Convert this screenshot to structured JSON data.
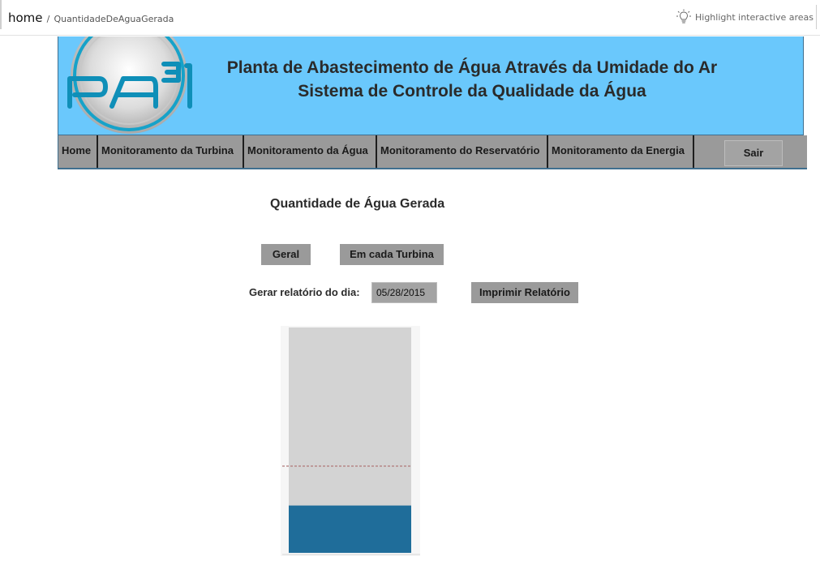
{
  "breadcrumb": {
    "home": "home",
    "separator": "/",
    "page": "QuantidadeDeAguaGerada"
  },
  "highlight": {
    "label": "Highlight interactive areas",
    "icon": "lightbulb-icon"
  },
  "header": {
    "logo_text": "PA³1",
    "title_line1": "Planta de Abastecimento de Água Através da Umidade do Ar",
    "title_line2": "Sistema de Controle da Qualidade da Água",
    "background": "#6ac8fc"
  },
  "nav": {
    "items": [
      {
        "label": "Home"
      },
      {
        "label": "Monitoramento da Turbina"
      },
      {
        "label": "Monitoramento da Água"
      },
      {
        "label": "Monitoramento do Reservatório"
      },
      {
        "label": "Monitoramento da Energia"
      }
    ],
    "logout_label": "Sair"
  },
  "main": {
    "title": "Quantidade de Água Gerada",
    "btn_geral": "Geral",
    "btn_turbina": "Em cada Turbina",
    "date_label": "Gerar relatório do dia:",
    "date_value": "05/28/2015",
    "btn_imprimir": "Imprimir Relatório"
  },
  "gauge": {
    "fill_fraction": 0.21,
    "marker_fraction": 0.385,
    "fill_color": "#1f6d9a",
    "track_color": "#d3d3d3",
    "marker_color": "#b07878"
  }
}
